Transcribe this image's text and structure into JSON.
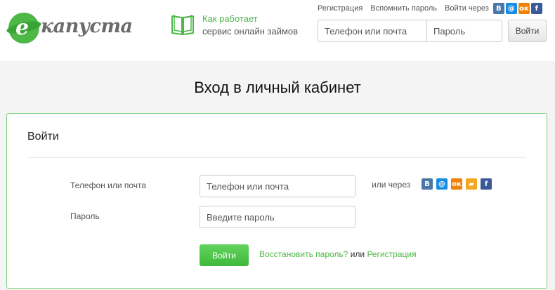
{
  "logo": {
    "letter": "e",
    "text": "капуста"
  },
  "how": {
    "title": "Как работает",
    "subtitle": "сервис онлайн займов",
    "icon": "book-icon"
  },
  "toplinks": {
    "register": "Регистрация",
    "remind": "Вспомнить пароль",
    "via": "Войти через"
  },
  "socials": [
    {
      "name": "vk-icon",
      "glyph": "В",
      "color": "#4a76a8"
    },
    {
      "name": "mail-icon",
      "glyph": "@",
      "color": "#168de2"
    },
    {
      "name": "ok-icon",
      "glyph": "ок",
      "color": "#ee8208"
    },
    {
      "name": "yandex-money-icon",
      "glyph": "▰",
      "color": "#f5a623"
    },
    {
      "name": "facebook-icon",
      "glyph": "f",
      "color": "#3b5998"
    }
  ],
  "header_form": {
    "phone_placeholder": "Телефон или почта",
    "password_placeholder": "Пароль",
    "button": "Войти"
  },
  "page": {
    "title": "Вход в личный кабинет"
  },
  "panel": {
    "title": "Войти",
    "phone_label": "Телефон или почта",
    "phone_placeholder": "Телефон или почта",
    "password_label": "Пароль",
    "password_placeholder": "Введите пароль",
    "or_via": "или через",
    "login_button": "Войти",
    "restore_link": "Восстановить пароль?",
    "or_word": " или ",
    "register_link": "Регистрация"
  },
  "colors": {
    "brand_green": "#4db848",
    "panel_border": "#7fcf7b"
  }
}
